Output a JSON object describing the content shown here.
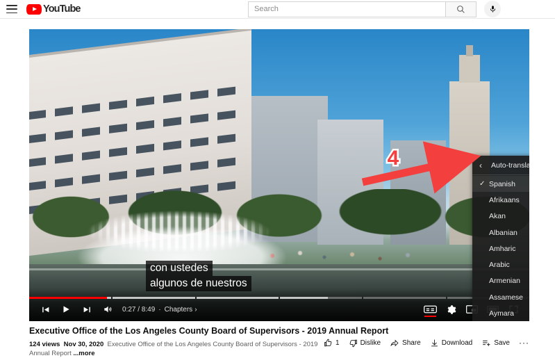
{
  "masthead": {
    "menu_icon": "hamburger-icon",
    "logo_text": "YouTube",
    "search": {
      "value": "",
      "placeholder": "Search"
    },
    "search_icon": "search-icon",
    "mic_icon": "microphone-icon"
  },
  "player": {
    "captions": [
      "con ustedes",
      "algunos de nuestros"
    ],
    "controls": {
      "prev_label": "previous-video",
      "play_label": "play",
      "next_label": "next-video",
      "volume_label": "volume",
      "time": "0:27 / 8:49",
      "separator": "·",
      "chapters_label": "Chapters",
      "chapters_chevron": "›",
      "subtitles_label": "subtitles-cc",
      "settings_label": "settings",
      "miniplayer_label": "miniplayer",
      "theater_label": "theater-mode",
      "fullscreen_label": "fullscreen"
    },
    "progress": {
      "played_percent": 5.2,
      "buffered_percent": 58,
      "chapter_count": 6,
      "played_color": "#ff0000",
      "buffered_color": "rgba(255,255,255,0.62)"
    }
  },
  "captions_panel": {
    "header": "Auto-translate",
    "back_icon": "chevron-left-icon",
    "check_glyph": "✓",
    "selected": "Spanish",
    "items": [
      {
        "label": "Spanish",
        "selected": true
      },
      {
        "label": "Afrikaans",
        "selected": false
      },
      {
        "label": "Akan",
        "selected": false
      },
      {
        "label": "Albanian",
        "selected": false
      },
      {
        "label": "Amharic",
        "selected": false
      },
      {
        "label": "Arabic",
        "selected": false
      },
      {
        "label": "Armenian",
        "selected": false
      },
      {
        "label": "Assamese",
        "selected": false
      },
      {
        "label": "Aymara",
        "selected": false
      }
    ]
  },
  "annotation": {
    "step_number": "4",
    "arrow_color": "#f43f3f",
    "number_color": "#f43f3f",
    "number_outline": "#ffffff"
  },
  "info": {
    "title": "Executive Office of the Los Angeles County Board of Supervisors - 2019 Annual Report",
    "views": "124 views",
    "date": "Nov 30, 2020",
    "description": "Executive Office of the Los Angeles County Board of Supervisors - 2019 Annual Report",
    "more_label": "...more",
    "actions": [
      {
        "name": "like",
        "label": "1",
        "icon": "thumbs-up-icon"
      },
      {
        "name": "dislike",
        "label": "Dislike",
        "icon": "thumbs-down-icon"
      },
      {
        "name": "share",
        "label": "Share",
        "icon": "share-arrow-icon"
      },
      {
        "name": "download",
        "label": "Download",
        "icon": "download-icon"
      },
      {
        "name": "save",
        "label": "Save",
        "icon": "save-playlist-icon"
      }
    ],
    "more_actions": "···"
  }
}
